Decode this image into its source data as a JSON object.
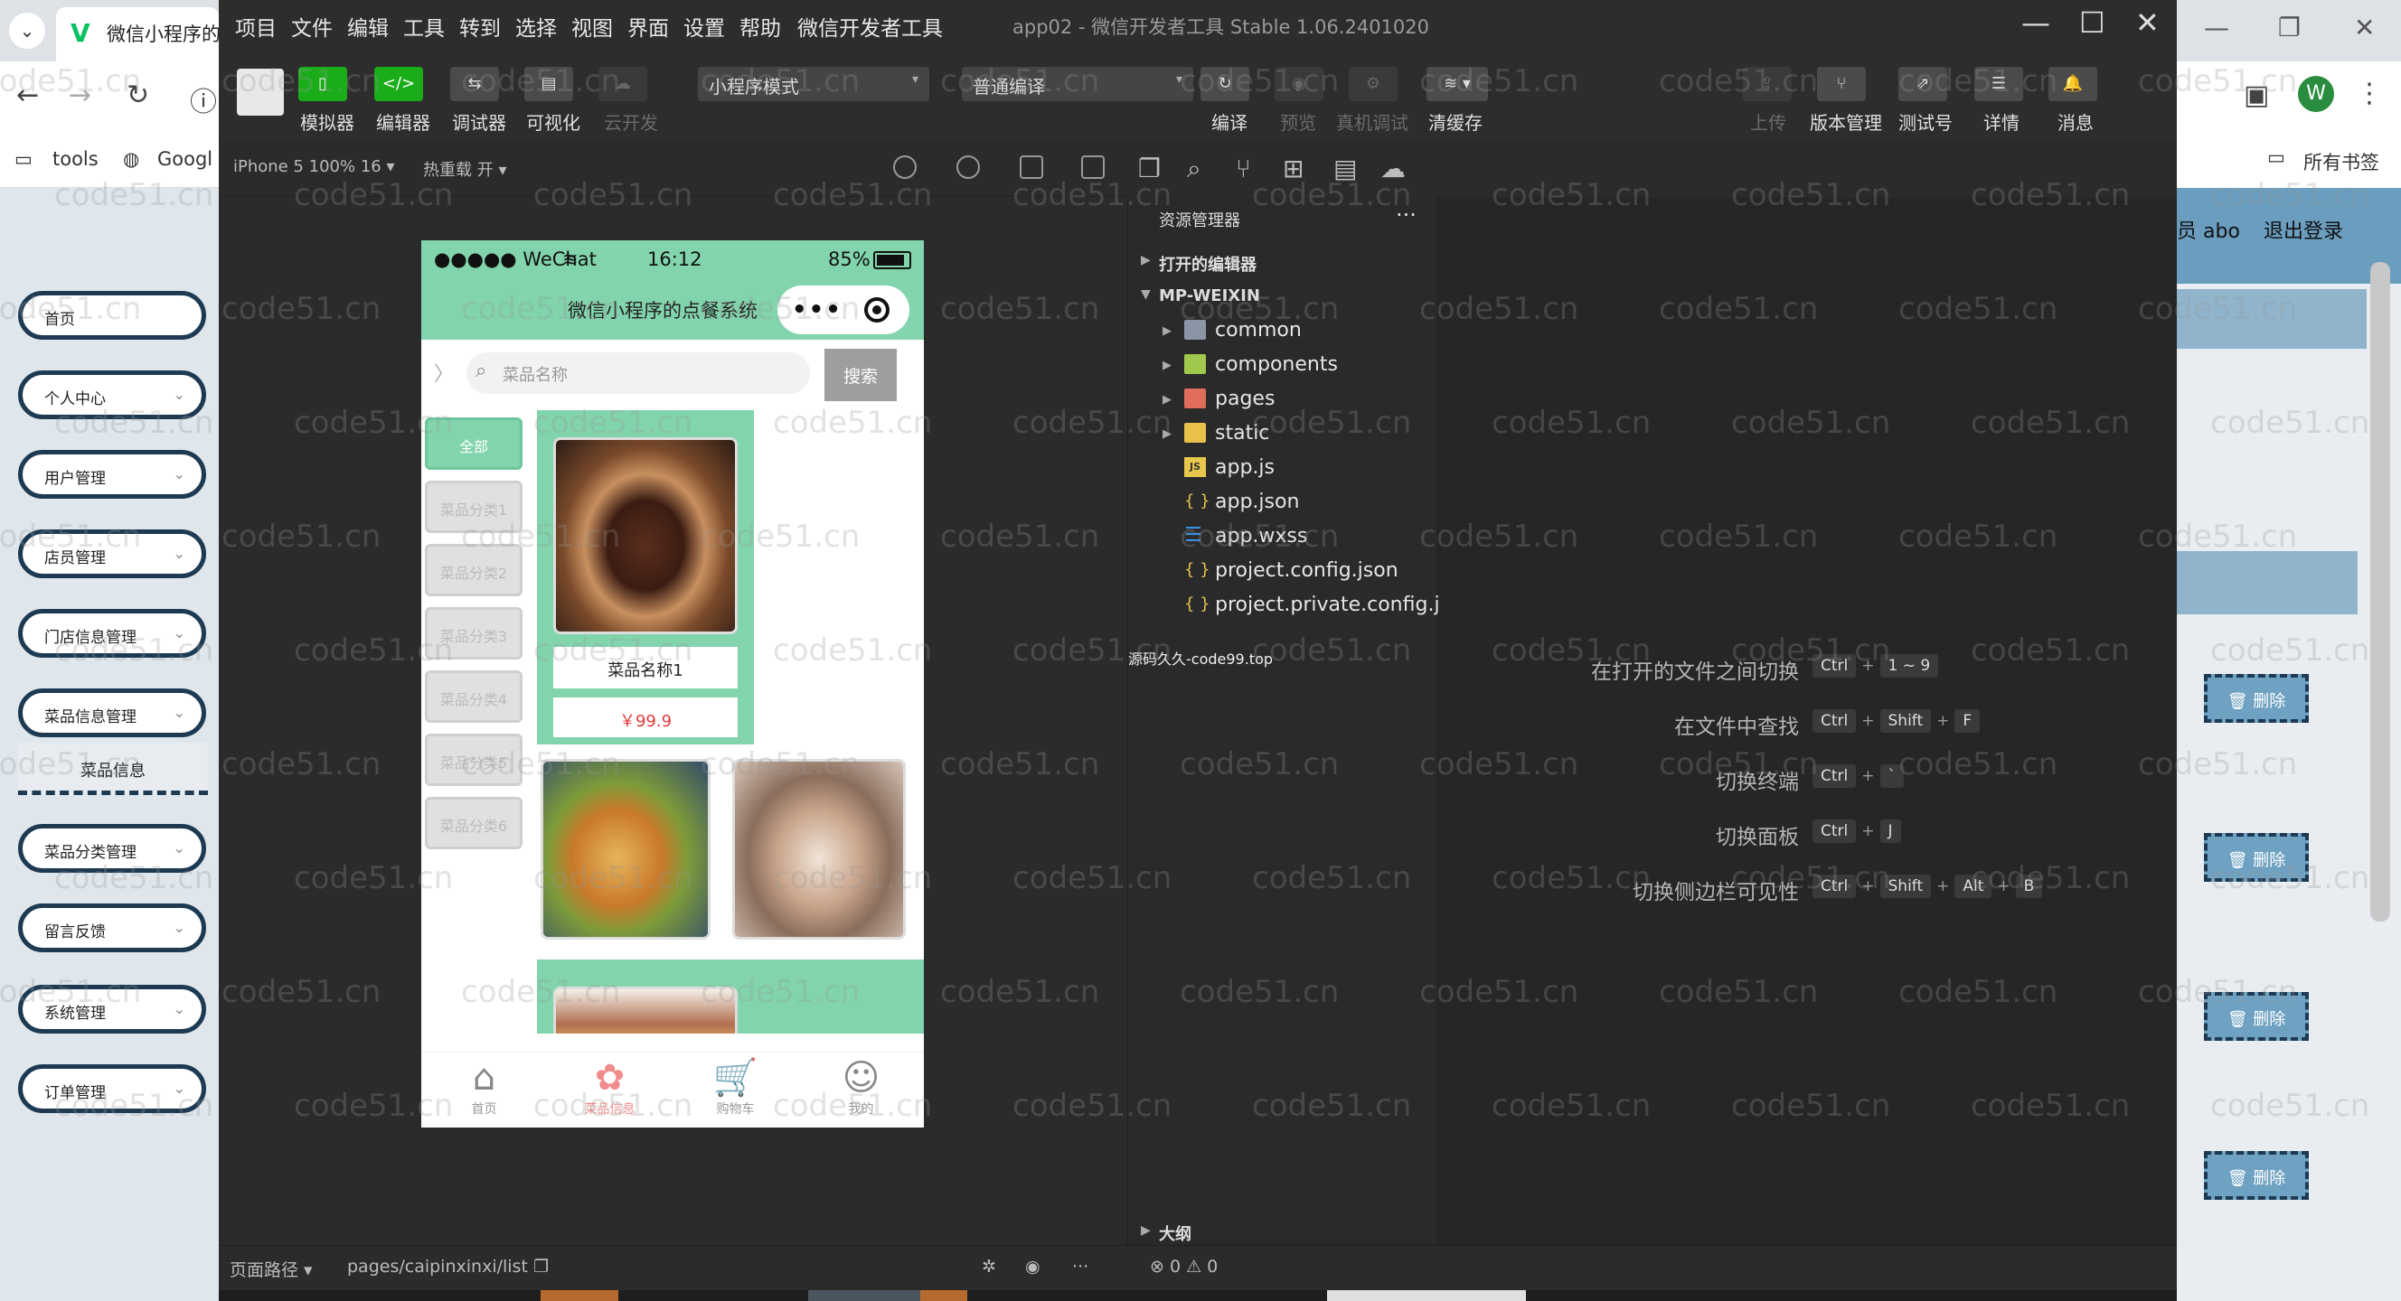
{
  "bg_left": {
    "tab_title": "微信小程序的",
    "bookmarks": [
      "tools",
      "Googl"
    ],
    "menu": [
      {
        "label": "首页",
        "chevron": false
      },
      {
        "label": "个人中心",
        "chevron": true
      },
      {
        "label": "用户管理",
        "chevron": true
      },
      {
        "label": "店员管理",
        "chevron": true
      },
      {
        "label": "门店信息管理",
        "chevron": true
      },
      {
        "label": "菜品信息管理",
        "chevron": true
      },
      {
        "label": "菜品分类管理",
        "chevron": true
      },
      {
        "label": "留言反馈",
        "chevron": true
      },
      {
        "label": "系统管理",
        "chevron": true
      },
      {
        "label": "订单管理",
        "chevron": true
      }
    ],
    "submenu_item": "菜品信息"
  },
  "bg_right": {
    "avatar_letter": "W",
    "bookmarks_folder": "所有书签",
    "user_fragment": "员 abo",
    "logout": "退出登录",
    "delete_label": "删除"
  },
  "menu": [
    "项目",
    "文件",
    "编辑",
    "工具",
    "转到",
    "选择",
    "视图",
    "界面",
    "设置",
    "帮助",
    "微信开发者工具"
  ],
  "window_title": "app02 - 微信开发者工具 Stable 1.06.2401020",
  "toolbar": {
    "simulator": "模拟器",
    "editor": "编辑器",
    "debugger": "调试器",
    "visual": "可视化",
    "cloud": "云开发",
    "mode": "小程序模式",
    "compile_mode": "普通编译",
    "compile": "编译",
    "preview": "预览",
    "real_debug": "真机调试",
    "clear_cache": "清缓存",
    "upload": "上传",
    "version": "版本管理",
    "test_account": "测试号",
    "details": "详情",
    "messages": "消息"
  },
  "simbar": {
    "device": "iPhone 5 100% 16 ▾",
    "hot_reload": "热重载 开 ▾"
  },
  "phone": {
    "status_left": "●●●●● WeChat",
    "time": "16:12",
    "battery": "85%",
    "nav_title": "微信小程序的点餐系统",
    "search_placeholder": "菜品名称",
    "search_button": "搜索",
    "categories": [
      "全部",
      "菜品分类1",
      "菜品分类2",
      "菜品分类3",
      "菜品分类4",
      "菜品分类5",
      "菜品分类6"
    ],
    "food_name": "菜品名称1",
    "food_price": "￥99.9",
    "tabs": [
      "首页",
      "菜品信息",
      "购物车",
      "我的"
    ]
  },
  "explorer": {
    "title": "资源管理器",
    "open_editors": "打开的编辑器",
    "project": "MP-WEIXIN",
    "items": [
      {
        "name": "common",
        "type": "folder",
        "color": "gray"
      },
      {
        "name": "components",
        "type": "folder",
        "color": "green"
      },
      {
        "name": "pages",
        "type": "folder",
        "color": "red"
      },
      {
        "name": "static",
        "type": "folder",
        "color": "yellow"
      },
      {
        "name": "app.js",
        "type": "js"
      },
      {
        "name": "app.json",
        "type": "json"
      },
      {
        "name": "app.wxss",
        "type": "css"
      },
      {
        "name": "project.config.json",
        "type": "json"
      },
      {
        "name": "project.private.config.js...",
        "type": "json"
      }
    ],
    "outline": "大纲",
    "watermark": "源码久久-code99.top"
  },
  "shortcuts": [
    {
      "label": "在打开的文件之间切换",
      "keys": [
        "Ctrl",
        "1 ~ 9"
      ]
    },
    {
      "label": "在文件中查找",
      "keys": [
        "Ctrl",
        "Shift",
        "F"
      ]
    },
    {
      "label": "切换终端",
      "keys": [
        "Ctrl",
        "`"
      ]
    },
    {
      "label": "切换面板",
      "keys": [
        "Ctrl",
        "J"
      ]
    },
    {
      "label": "切换侧边栏可见性",
      "keys": [
        "Ctrl",
        "Shift",
        "Alt",
        "B"
      ]
    }
  ],
  "statusbar": {
    "page_path_label": "页面路径 ▾",
    "page_path": "pages/caipinxinxi/list",
    "errors": "⊗ 0 ⚠ 0"
  },
  "site_watermark": "code51.cn"
}
